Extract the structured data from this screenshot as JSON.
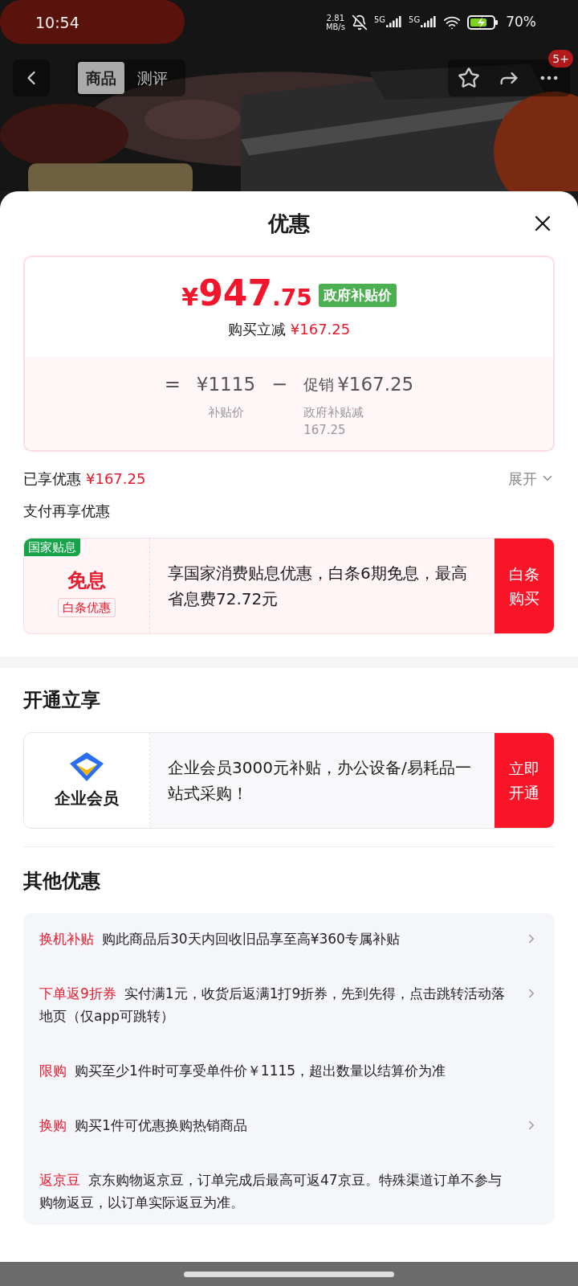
{
  "status_bar": {
    "time": "10:54",
    "speed_value": "2.81",
    "speed_unit": "MB/s",
    "networks": [
      "5G",
      "5G"
    ],
    "battery": "70%"
  },
  "nav": {
    "tabs": [
      {
        "label": "商品",
        "selected": true
      },
      {
        "label": "测评",
        "selected": false
      }
    ],
    "badge": "5+"
  },
  "sheet": {
    "title": "优惠",
    "price": {
      "currency": "¥",
      "integer": "947",
      "decimal": ".75",
      "tag": "政府补贴价",
      "reduce_label": "购买立减",
      "reduce_amount": "¥167.25"
    },
    "breakdown": {
      "equals": "=",
      "base": "¥1115",
      "base_label": "补贴价",
      "minus": "−",
      "promo_label": "促销",
      "promo_amount": "¥167.25",
      "promo_note_lines": [
        "政府补贴减",
        "167.25"
      ]
    },
    "enjoyed": {
      "label": "已享优惠",
      "amount": "¥167.25",
      "toggle": "展开",
      "expanded": false
    },
    "pay_title": "支付再享优惠",
    "interest_card": {
      "tag": "国家贴息",
      "title": "免息",
      "subtitle": "白条优惠",
      "text": "享国家消费贴息优惠，白条6期免息，最高省息费72.72元",
      "button": "白条购买"
    },
    "open_title": "开通立享",
    "member_card": {
      "name": "企业会员",
      "text": "企业会员3000元补贴，办公设备/易耗品一站式采购！",
      "button": "立即开通"
    },
    "other_title": "其他优惠",
    "other_items": [
      {
        "tag": "换机补贴",
        "text": "购此商品后30天内回收旧品享至高¥360专属补贴",
        "linked": true
      },
      {
        "tag": "下单返9折券",
        "text": "实付满1元，收货后返满1打9折券，先到先得，点击跳转活动落地页（仅app可跳转）",
        "linked": true
      },
      {
        "tag": "限购",
        "text": "购买至少1件时可享受单件价￥1115，超出数量以结算价为准",
        "linked": false
      },
      {
        "tag": "换购",
        "text": "购买1件可优惠换购热销商品",
        "linked": true
      },
      {
        "tag": "返京豆",
        "text": "京东购物返京豆，订单完成后最高可返47京豆。特殊渠道订单不参与购物返豆，以订单实际返豆为准。",
        "linked": false
      }
    ]
  }
}
